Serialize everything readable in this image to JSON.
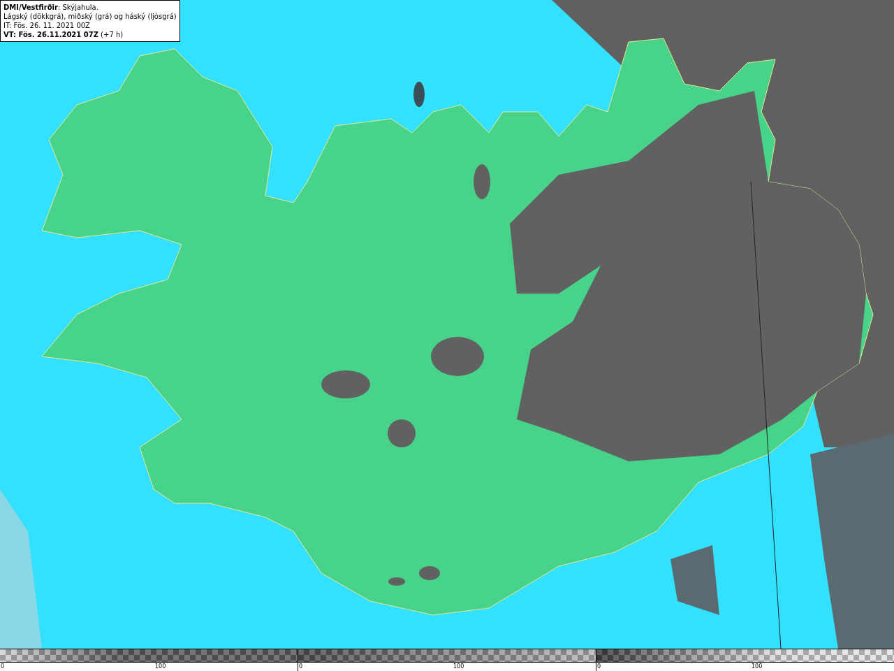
{
  "legend": {
    "lines": [
      "**DMI/Vestfirðir**: Skýjahula.",
      "Lágský (dökkgrá), miðský (grá) og háský (ljósgrá)",
      "IT: Fös. 26. 11. 2021 00Z",
      "**VT: Fös. 26.11.2021 07Z** (+7 h)"
    ]
  },
  "colorbars": [
    {
      "ticks": [
        "0",
        "100"
      ]
    },
    {
      "ticks": [
        "0",
        "100"
      ]
    },
    {
      "ticks": [
        "0",
        "100"
      ]
    }
  ]
}
